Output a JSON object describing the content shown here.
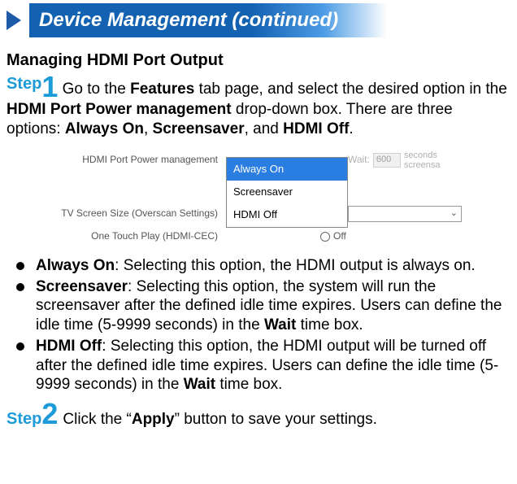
{
  "header": {
    "title": "Device Management (continued)"
  },
  "section": {
    "heading": "Managing HDMI Port Output"
  },
  "step1": {
    "label": "Step",
    "num": "1",
    "pre": " Go to the ",
    "features": "Features",
    "mid1": " tab page, and select the desired option in the ",
    "hdmi_mgmt": "HDMI Port Power management",
    "mid2": " drop-down box. There are three options: ",
    "opt_on": "Always On",
    "sep1": ", ",
    "opt_ss": "Screensaver",
    "sep2": ", and ",
    "opt_off": "HDMI Off",
    "period": "."
  },
  "screenshot": {
    "row1_label": "HDMI Port Power management",
    "row2_label": "TV Screen Size (Overscan Settings)",
    "row3_label": "One Touch Play (HDMI-CEC)",
    "dropdown": {
      "opt1": "Always On",
      "opt2": "Screensaver",
      "opt3": "HDMI Off"
    },
    "wait_label": "Wait:",
    "wait_value": "600",
    "wait_suffix1": "seconds",
    "wait_suffix2": "screensa",
    "radio_off_label": "Off"
  },
  "bullets": {
    "b1_name": "Always On",
    "b1_text": ": Selecting this option, the HDMI output is always on.",
    "b2_name": "Screensaver",
    "b2_text_a": ": Selecting this option, the system will run the screensaver after the defined idle time expires. Users can define the idle time (5-9999 seconds) in the ",
    "b2_wait": "Wait",
    "b2_text_b": " time box.",
    "b3_name": "HDMI Off",
    "b3_text_a": ": Selecting this option, the HDMI output will be turned off after the defined idle time expires. Users can define the idle time (5-9999 seconds) in the ",
    "b3_wait": "Wait",
    "b3_text_b": " time box."
  },
  "step2": {
    "label": "Step",
    "num": "2",
    "pre": "  Click the “",
    "apply": "Apply",
    "post": "” button to save your settings."
  }
}
